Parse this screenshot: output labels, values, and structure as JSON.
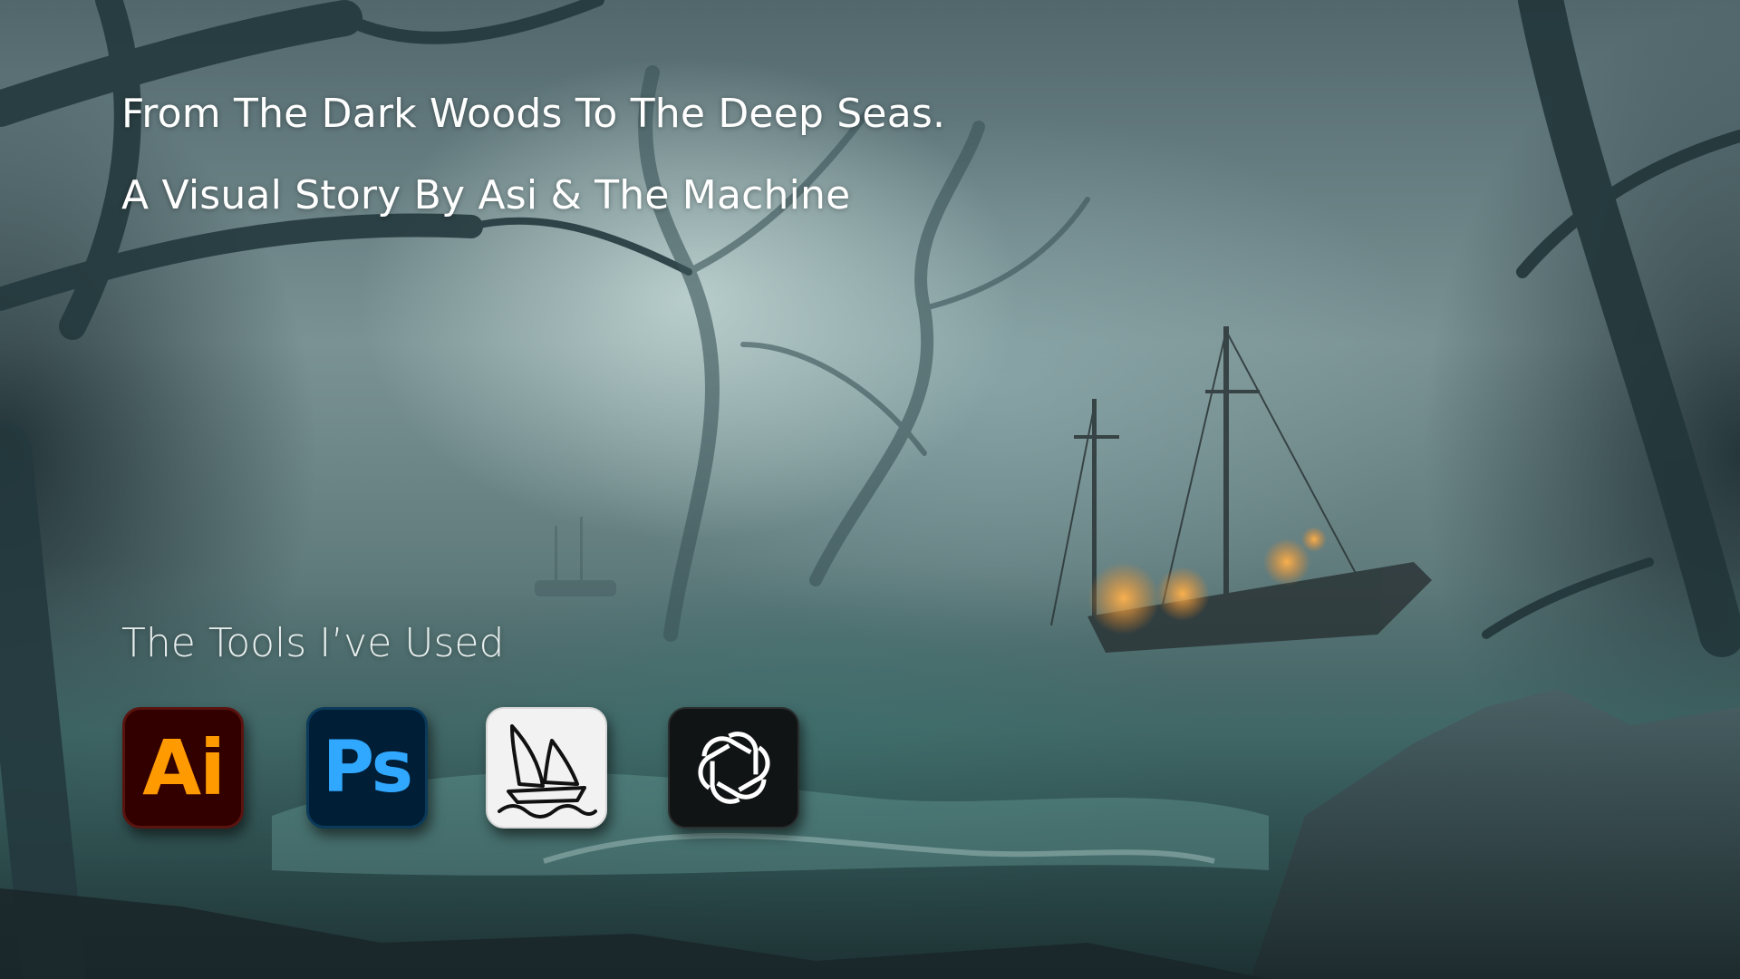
{
  "slide": {
    "title_line_1": "From The Dark Woods To The Deep Seas.",
    "title_line_2": "A Visual Story By Asi & The Machine",
    "tools_heading": "The Tools I’ve Used"
  },
  "tools": [
    {
      "icon": "adobe-illustrator-icon",
      "label": "Ai",
      "bg": "#330000",
      "fg": "#ff9a00"
    },
    {
      "icon": "adobe-photoshop-icon",
      "label": "Ps",
      "bg": "#001e36",
      "fg": "#31a8ff"
    },
    {
      "icon": "midjourney-sailboat-icon",
      "bg": "#f2f2f2",
      "fg": "#111111"
    },
    {
      "icon": "openai-chatgpt-icon",
      "bg": "#111414",
      "fg": "#ffffff"
    }
  ]
}
